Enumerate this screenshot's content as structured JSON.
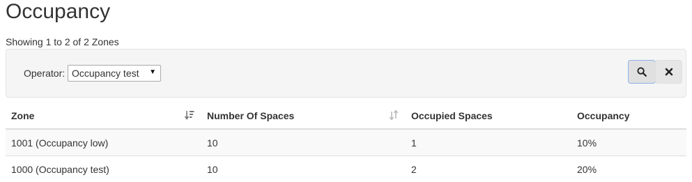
{
  "page": {
    "title": "Occupancy",
    "showing": "Showing 1 to 2 of 2 Zones"
  },
  "filter": {
    "operator_label": "Operator:",
    "operator_value": "Occupancy test",
    "search_icon": "search-icon",
    "clear_icon": "close-icon"
  },
  "table": {
    "columns": [
      "Zone",
      "Number Of Spaces",
      "Occupied Spaces",
      "Occupancy"
    ],
    "rows": [
      [
        "1001 (Occupancy low)",
        "10",
        "1",
        "10%"
      ],
      [
        "1000 (Occupancy test)",
        "10",
        "2",
        "20%"
      ]
    ]
  }
}
